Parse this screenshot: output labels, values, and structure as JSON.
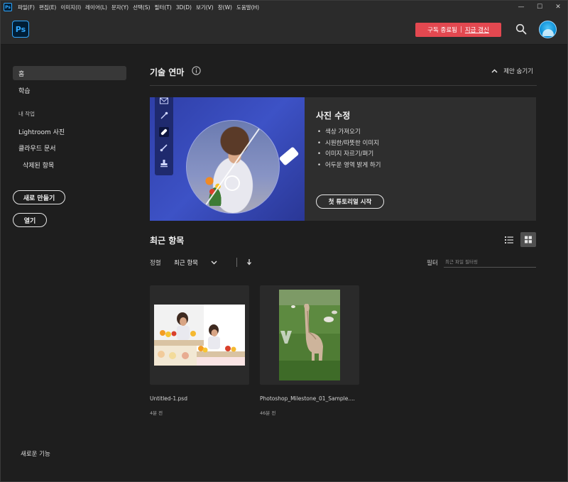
{
  "app": {
    "logo": "Ps",
    "mini_logo": "Ps"
  },
  "menubar": {
    "items": [
      "파일(F)",
      "편집(E)",
      "이미지(I)",
      "레이어(L)",
      "문자(Y)",
      "선택(S)",
      "필터(T)",
      "3D(D)",
      "보기(V)",
      "창(W)",
      "도움말(H)"
    ],
    "controls": [
      "—",
      "☐",
      "✕"
    ]
  },
  "header": {
    "banner_text": "구독 종료됨",
    "banner_separator": "|",
    "banner_link": "지금 갱신"
  },
  "sidebar": {
    "home": "홈",
    "learn": "학습",
    "my_work": "내 작업",
    "lightroom": "Lightroom 사진",
    "cloud_docs": "클라우드 문서",
    "deleted": "삭제된 항목",
    "new_button": "새로 만들기",
    "open_button": "열기",
    "whats_new": "새로운 기능"
  },
  "tutorial": {
    "section_title": "기술 연마",
    "hide_label": "제안 숨기기",
    "card_title": "사진 수정",
    "items": [
      "색상 가져오기",
      "시원한/따뜻한 이미지",
      "이미지 자르기/펴기",
      "어두운 영역 밝게 하기"
    ],
    "start_button": "첫 튜토리얼 시작"
  },
  "recent": {
    "title": "최근 항목",
    "sort_label": "정렬",
    "sort_value": "최근 항목",
    "filter_label": "필터",
    "filter_placeholder": "최근 파일 필터링",
    "files": [
      {
        "name": "Untitled-1.psd",
        "time": "4분 전"
      },
      {
        "name": "Photoshop_Milestone_01_Sample....",
        "time": "46분 전"
      }
    ]
  },
  "colors": {
    "accent": "#31a8ff",
    "banner": "#e34850",
    "background": "#1e1e1e"
  }
}
